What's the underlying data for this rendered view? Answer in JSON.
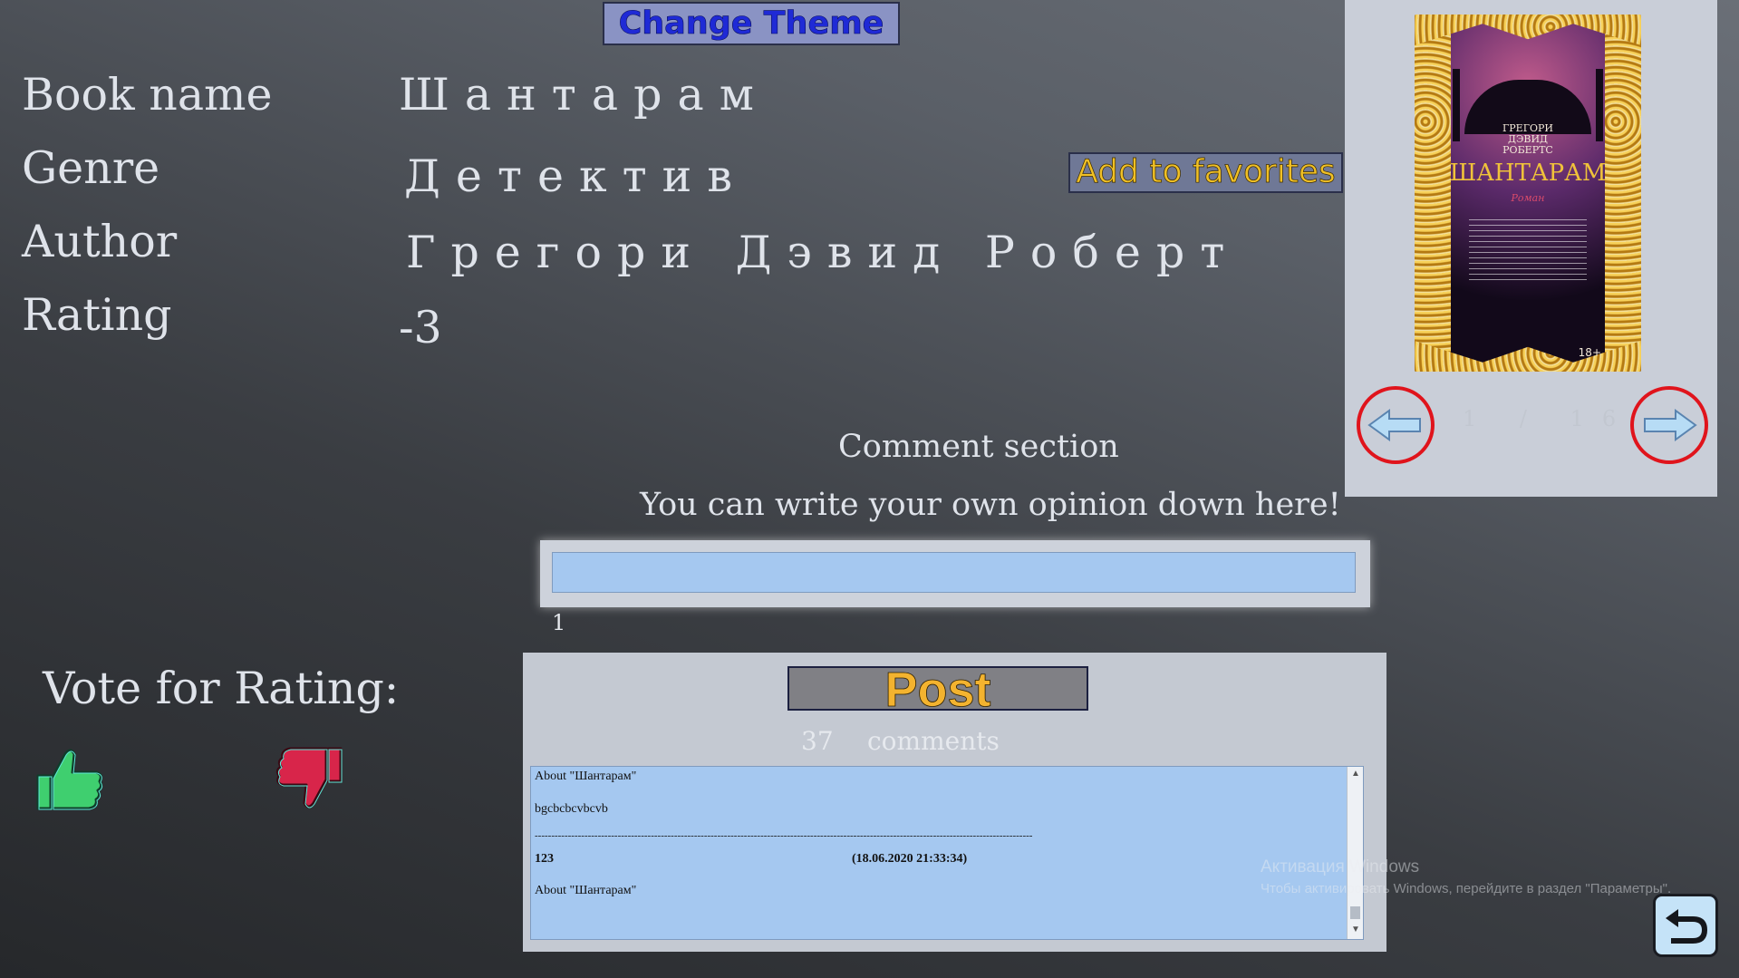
{
  "toolbar": {
    "change_theme_label": "Change Theme"
  },
  "book": {
    "fields": [
      {
        "label": "Book name",
        "value": "Шантарам"
      },
      {
        "label": "Genre",
        "value": "Детектив"
      },
      {
        "label": "Author",
        "value": "Грегори Дэвид Роберт"
      },
      {
        "label": "Rating",
        "value": "-3"
      }
    ],
    "add_favorites_label": "Add to favorites"
  },
  "cover": {
    "author_line1": "ГРЕГОРИ",
    "author_line2": "ДЭВИД",
    "author_line3": "РОБЕРТС",
    "title": "ШАНТАРАМ",
    "subtitle": "Роман",
    "age_rating": "18+",
    "pager_text": "1 / 16",
    "prev_icon": "arrow-left-icon",
    "next_icon": "arrow-right-icon"
  },
  "comments": {
    "section_title": "Comment section",
    "subtitle": "You can write your own opinion down here!",
    "input_value": "",
    "char_count": "1",
    "post_label": "Post",
    "count": "37",
    "count_word": "comments",
    "items": [
      {
        "about": "About \"Шантарам\"",
        "text": "bgcbcbcvbcvb",
        "separator": "------------------------------------------------------------------------------------------------------------------------------------------------------"
      },
      {
        "user": "123",
        "date": "(18.06.2020 21:33:34)",
        "about": "About \"Шантарам\""
      }
    ]
  },
  "vote": {
    "label": "Vote for Rating:",
    "up_icon": "thumbs-up-icon",
    "down_icon": "thumbs-down-icon"
  },
  "watermark": {
    "line1": "Активация Windows",
    "line2": "Чтобы активировать Windows, перейдите в раздел \"Параметры\"."
  },
  "back_icon": "return-icon",
  "colors": {
    "input_bg": "#a5c8f0",
    "post_text": "#f3b32f",
    "theme_text": "#1f2ad6",
    "arrow_ring": "#e0141c",
    "thumb_up": "#3fcf6f",
    "thumb_down": "#d8254a"
  }
}
